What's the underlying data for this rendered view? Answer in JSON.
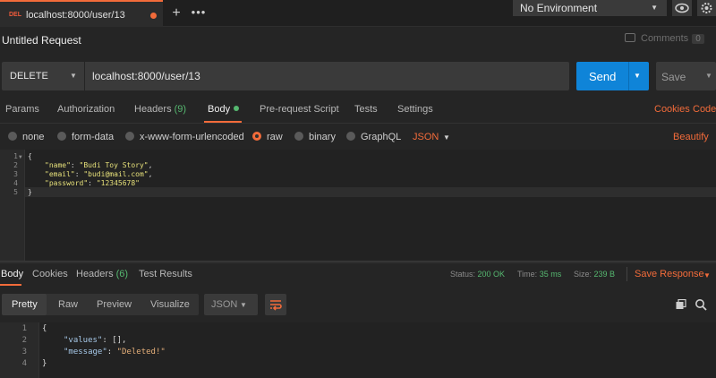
{
  "tab": {
    "method": "DEL",
    "url": "localhost:8000/user/13",
    "add": "+",
    "more": "•••"
  },
  "environment": {
    "selected": "No Environment"
  },
  "request": {
    "title": "Untitled Request",
    "comments_label": "Comments",
    "comments_count": "0",
    "method": "DELETE",
    "url": "localhost:8000/user/13",
    "send_label": "Send",
    "save_label": "Save"
  },
  "request_tabs": {
    "params": "Params",
    "authorization": "Authorization",
    "headers": "Headers",
    "headers_count": "(9)",
    "body": "Body",
    "prerequest": "Pre-request Script",
    "tests": "Tests",
    "settings": "Settings",
    "cookies": "Cookies",
    "code": "Code"
  },
  "body_modes": {
    "none": "none",
    "form_data": "form-data",
    "urlencoded": "x-www-form-urlencoded",
    "raw": "raw",
    "binary": "binary",
    "graphql": "GraphQL",
    "language": "JSON",
    "beautify": "Beautify"
  },
  "request_body": {
    "line_numbers": [
      "1",
      "2",
      "3",
      "4",
      "5"
    ],
    "open": "{",
    "name_key": "\"name\"",
    "name_val": "\"Budi Toy Story\"",
    "email_key": "\"email\"",
    "email_val": "\"budi@mail.com\"",
    "password_key": "\"password\"",
    "password_val": "\"12345678\"",
    "close": "}"
  },
  "response_tabs": {
    "body": "Body",
    "cookies": "Cookies",
    "headers": "Headers",
    "headers_count": "(6)",
    "test_results": "Test Results"
  },
  "response_meta": {
    "status_label": "Status:",
    "status_value": "200 OK",
    "time_label": "Time:",
    "time_value": "35 ms",
    "size_label": "Size:",
    "size_value": "239 B",
    "save_response": "Save Response"
  },
  "response_view": {
    "pretty": "Pretty",
    "raw": "Raw",
    "preview": "Preview",
    "visualize": "Visualize",
    "language": "JSON"
  },
  "response_body": {
    "line_numbers": [
      "1",
      "2",
      "3",
      "4"
    ],
    "open": "{",
    "values_key": "\"values\"",
    "values_val": "[],",
    "message_key": "\"message\"",
    "message_val": "\"Deleted!\"",
    "close": "}"
  },
  "colors": {
    "accent": "#f26b3a",
    "send": "#0f84d8",
    "success": "#56b870"
  }
}
